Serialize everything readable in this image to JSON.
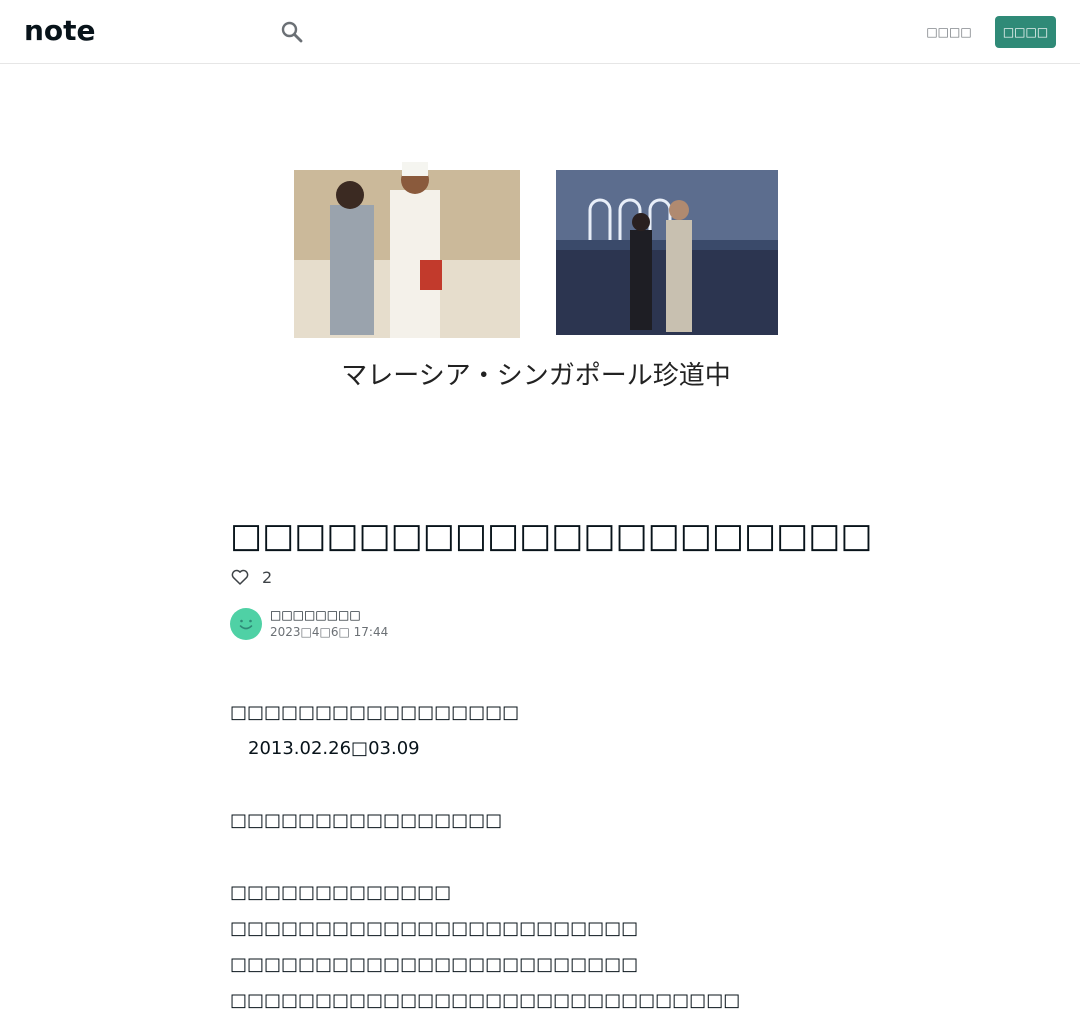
{
  "header": {
    "logo_text": "note",
    "login_label": "□□□□",
    "signup_label": "□□□□"
  },
  "hero": {
    "caption": "マレーシア・シンガポール珍道中"
  },
  "article": {
    "title": "□□□□□□□□□□□□□□□□□□□□",
    "like_count": "2",
    "author_name": "□□□□□□□□",
    "date": "2023□4□6□ 17:44",
    "paragraphs": [
      "□□□□□□□□□□□□□□□□□",
      "　2013.02.26□03.09",
      "",
      "□□□□□□□□□□□□□□□□",
      "",
      "□□□□□□□□□□□□□",
      "□□□□□□□□□□□□□□□□□□□□□□□□",
      "□□□□□□□□□□□□□□□□□□□□□□□□",
      "□□□□□□□□□□□□□□□□□□□□□□□□□□□□□□"
    ]
  },
  "colors": {
    "accent": "#2f8a77",
    "avatar": "#4fd1a5"
  }
}
